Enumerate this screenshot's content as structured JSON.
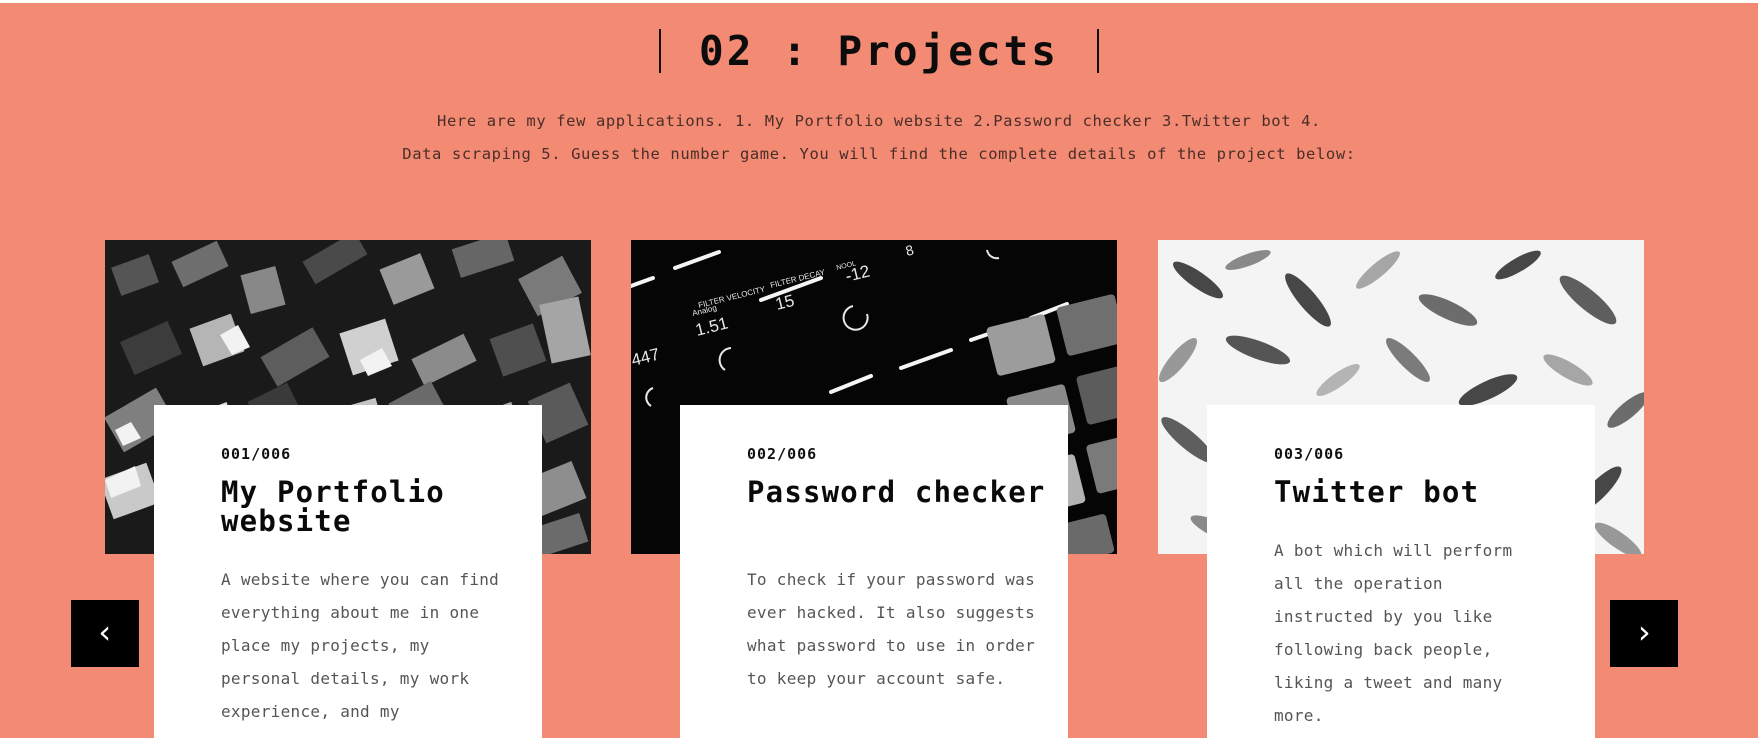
{
  "section": {
    "title": "02 : Projects",
    "intro_line1": "Here are my few applications. 1. My Portfolio website 2.Password checker 3.Twitter bot 4.",
    "intro_line2": "Data scraping 5. Guess the number game. You will find the complete details of the project below:"
  },
  "nav": {
    "prev": "‹",
    "next": "›"
  },
  "projects": [
    {
      "number": "001/006",
      "title": "My Portfolio website",
      "description": "A website where you can find everything about me in one place my projects, my personal details, my work experience, and my",
      "image": "metal-type-letters-photo"
    },
    {
      "number": "002/006",
      "title": "Password checker",
      "description": "To check if your password was ever hacked. It also suggests what password to use in order to keep your account safe.",
      "image": "audio-controller-pads-photo",
      "image_text": {
        "filter_velocity_label": "FILTER VELOCITY",
        "filter_decay_label": "FILTER DECAY",
        "nool_label": "NOOL",
        "analog_label": "Analog",
        "v1": "1.51",
        "v2": "15",
        "v3": "-12",
        "v4": "8",
        "v5": "447"
      }
    },
    {
      "number": "003/006",
      "title": "Twitter bot",
      "description": "A bot which will perform all the operation instructed by you like following back people, liking a tweet and many more.",
      "image": "leaf-pattern-photo"
    }
  ],
  "colors": {
    "background": "#f38a74",
    "card": "#ffffff",
    "button": "#000000"
  }
}
